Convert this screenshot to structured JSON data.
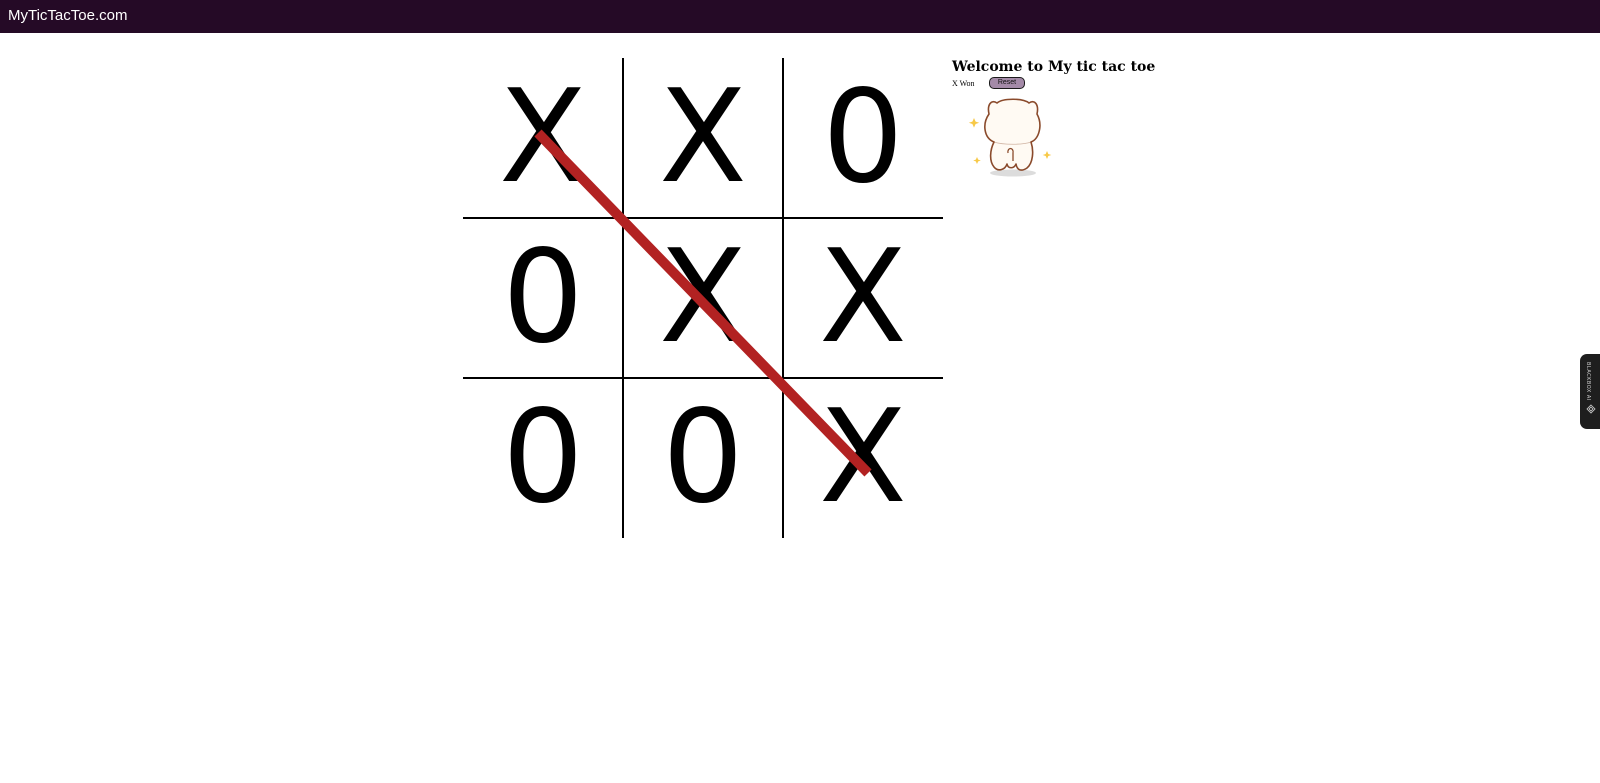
{
  "header": {
    "brand": "MyTicTacToe.com"
  },
  "board": {
    "cells": [
      "X",
      "X",
      "0",
      "0",
      "X",
      "X",
      "0",
      "0",
      "X"
    ],
    "winning_line": [
      0,
      4,
      8
    ],
    "win_line_color": "#b22222"
  },
  "panel": {
    "title": "Welcome to My tic tac toe",
    "status": "X Won",
    "reset_label": "Reset",
    "celebration_image": "cute-cat-celebrating"
  },
  "extension_tab": {
    "label": "BLACKBOX AI",
    "icon": "blackbox-logo-icon"
  },
  "colors": {
    "navbar": "#250a26",
    "reset_button": "#a48aa8",
    "marks": "#000000"
  }
}
